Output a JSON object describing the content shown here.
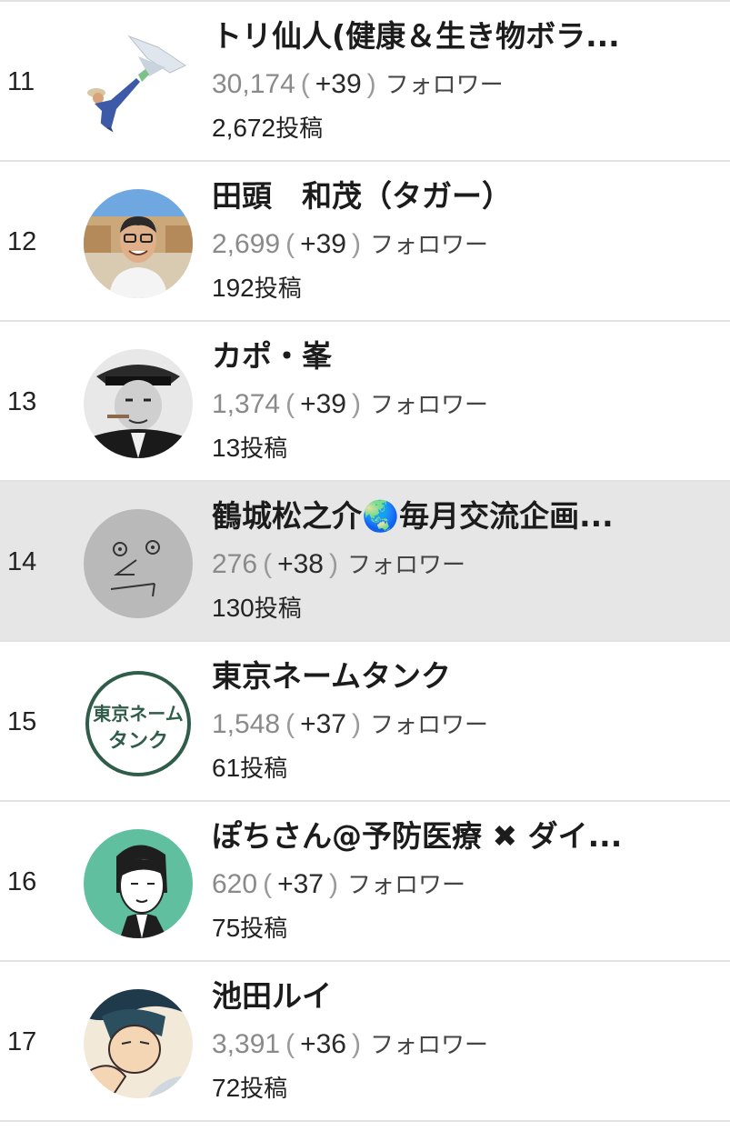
{
  "ranking": {
    "follower_suffix": "フォロワー",
    "posts_suffix": "投稿",
    "rows": [
      {
        "rank": "11",
        "name": "トリ仙人(健康＆生き物ボラ...",
        "followers": "30,174",
        "delta": "+39",
        "posts": "2,672",
        "avatar": "man-flying-kite-icon",
        "highlighted": false
      },
      {
        "rank": "12",
        "name": "田頭　和茂（タガー）",
        "followers": "2,699",
        "delta": "+39",
        "posts": "192",
        "avatar": "smiling-man-glasses-icon",
        "highlighted": false
      },
      {
        "rank": "13",
        "name": "カポ・峯",
        "followers": "1,374",
        "delta": "+39",
        "posts": "13",
        "avatar": "man-with-hat-cigar-icon",
        "highlighted": false
      },
      {
        "rank": "14",
        "name": "鶴城松之介🌏毎月交流企画...",
        "followers": "276",
        "delta": "+38",
        "posts": "130",
        "avatar": "doodle-face-icon",
        "highlighted": true
      },
      {
        "rank": "15",
        "name": "東京ネームタンク",
        "followers": "1,548",
        "delta": "+37",
        "posts": "61",
        "avatar": "tokyo-name-tank-logo-icon",
        "highlighted": false
      },
      {
        "rank": "16",
        "name": "ぽちさん@予防医療 ✖ ダイ...",
        "followers": "620",
        "delta": "+37",
        "posts": "75",
        "avatar": "illustrated-man-portrait-icon",
        "highlighted": false
      },
      {
        "rank": "17",
        "name": "池田ルイ",
        "followers": "3,391",
        "delta": "+36",
        "posts": "72",
        "avatar": "manga-character-icon",
        "highlighted": false
      }
    ],
    "colors": {
      "highlight_bg": "#e6e6e6",
      "follower_count": "#8a8a8a",
      "divider": "#e2e2e2",
      "logo_green": "#2f5d4a",
      "avatar_teal": "#5fbf9f"
    },
    "avatar_logo_text": {
      "line1": "東京ネーム",
      "line2": "タンク"
    }
  }
}
